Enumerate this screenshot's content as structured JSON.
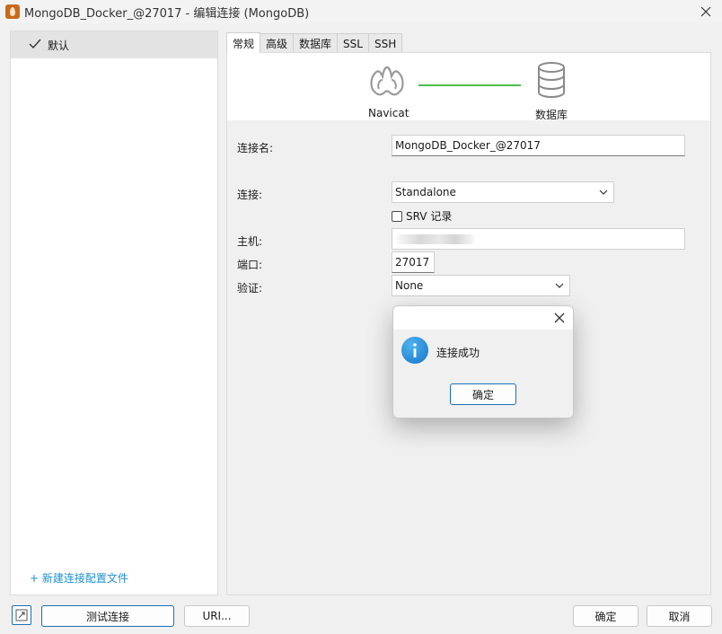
{
  "window": {
    "title": "MongoDB_Docker_@27017 - 编辑连接 (MongoDB)",
    "app_icon": "mongodb-leaf-icon",
    "close_icon": "close-icon"
  },
  "sidebar": {
    "profiles": [
      {
        "label": "默认",
        "selected": true,
        "icon": "check-icon"
      }
    ],
    "new_profile_label": "+ 新建连接配置文件"
  },
  "tabs": [
    {
      "label": "常规",
      "active": true
    },
    {
      "label": "高级",
      "active": false
    },
    {
      "label": "数据库",
      "active": false
    },
    {
      "label": "SSL",
      "active": false
    },
    {
      "label": "SSH",
      "active": false
    }
  ],
  "diagram": {
    "left_label": "Navicat",
    "right_label": "数据库",
    "link_color": "#4cc04c"
  },
  "form": {
    "connection_name_label": "连接名:",
    "connection_name_value": "MongoDB_Docker_@27017",
    "connection_type_label": "连接:",
    "connection_type_value": "Standalone",
    "srv_label": "SRV 记录",
    "srv_checked": false,
    "host_label": "主机:",
    "port_label": "端口:",
    "port_value": "27017",
    "auth_label": "验证:",
    "auth_value": "None"
  },
  "dialog": {
    "message": "连接成功",
    "ok_label": "确定",
    "icon": "info-icon"
  },
  "footer": {
    "test_connection_label": "测试连接",
    "uri_label": "URI...",
    "ok_label": "确定",
    "cancel_label": "取消"
  },
  "colors": {
    "accent": "#1b6fb7",
    "link": "#1e8fce",
    "success": "#4cc04c"
  }
}
